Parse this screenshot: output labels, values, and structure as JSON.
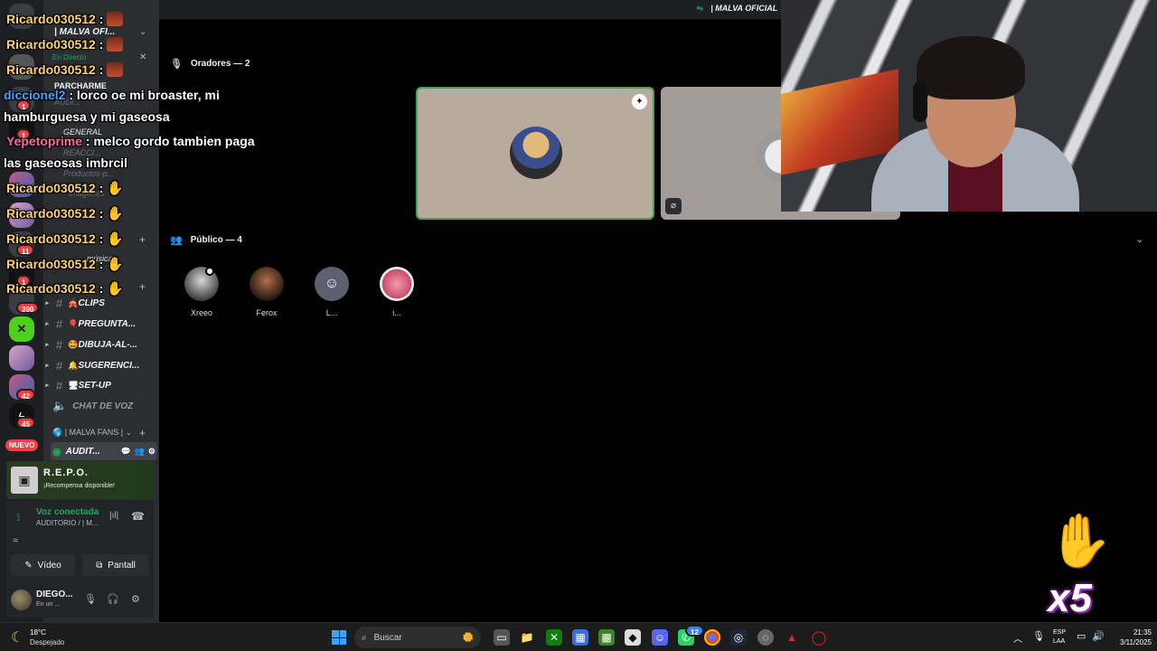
{
  "server_rail": {
    "badges": [
      "1",
      "1",
      "11",
      "1",
      "390",
      "42",
      "45"
    ],
    "nuevo_label": "NUEVO"
  },
  "channels": {
    "guild_name": "| MALVA OFI...",
    "live_label": "En Directo",
    "parcharme_label": "PARCHARME",
    "faint_lines": [
      "AUDI...",
      "Productos-p...",
      "Imagenes",
      "GENERAL",
      "REACCI...",
      "música"
    ],
    "items": [
      {
        "label": "CLIPS",
        "emoji": "🎪"
      },
      {
        "label": "PREGUNTA...",
        "emoji": "🎈"
      },
      {
        "label": "DIBUJA-AL-...",
        "emoji": "🤩"
      },
      {
        "label": "SUGERENCI...",
        "emoji": "🔔"
      },
      {
        "label": "SET-UP",
        "emoji": "🖥"
      }
    ],
    "voice_channel": "CHAT DE VOZ",
    "fans_category": "| MALVA FANS |",
    "active_channel": "AUDIT..."
  },
  "repo_card": {
    "title": "R.E.P.O.",
    "subtitle": "¡Recompensa disponible!"
  },
  "voice": {
    "status": "Voz conectada",
    "location": "AUDITORIO / | M...",
    "video_label": "Vídeo",
    "screen_label": "Pantall"
  },
  "user": {
    "name": "DIEGO...",
    "status": "En un ..."
  },
  "stage": {
    "title": "| MALVA OFICIAL",
    "speakers_header": "Oradores — 2",
    "audience_header": "Público — 4",
    "audience": [
      {
        "name": "Xreeo"
      },
      {
        "name": "Ferox"
      },
      {
        "name": "L..."
      },
      {
        "name": "i..."
      }
    ]
  },
  "overlay_chat": [
    {
      "user": "Ricardo030512",
      "text": ":"
    },
    {
      "user": "Ricardo030512",
      "text": ":"
    },
    {
      "user": "Ricardo030512",
      "text": ":"
    },
    {
      "user": "diccionel2",
      "text": ": lorco oe mi broaster, mi"
    },
    {
      "user": "",
      "text": "hamburguesa y mi gaseosa"
    },
    {
      "user": "Yepetoprime",
      "text": ": melco gordo tambien paga"
    },
    {
      "user": "",
      "text": "las gaseosas imbrcil"
    },
    {
      "user": "Ricardo030512",
      "text": ":"
    },
    {
      "user": "Ricardo030512",
      "text": ":"
    },
    {
      "user": "Ricardo030512",
      "text": ":"
    },
    {
      "user": "Ricardo030512",
      "text": ":"
    },
    {
      "user": "Ricardo030512",
      "text": ":"
    }
  ],
  "multiplier_overlay": "x5",
  "taskbar": {
    "weather_temp": "18°C",
    "weather_desc": "Despejado",
    "search_placeholder": "Buscar",
    "lang_line1": "ESP",
    "lang_line2": "LAA",
    "time": "21:35",
    "date": "3/11/2025",
    "app_badges": [
      "12"
    ]
  },
  "colors": {
    "accent_green": "#23a55a",
    "danger_red": "#f23f43",
    "discord_bg": "#2b2d31",
    "stage_bg": "#000000"
  }
}
